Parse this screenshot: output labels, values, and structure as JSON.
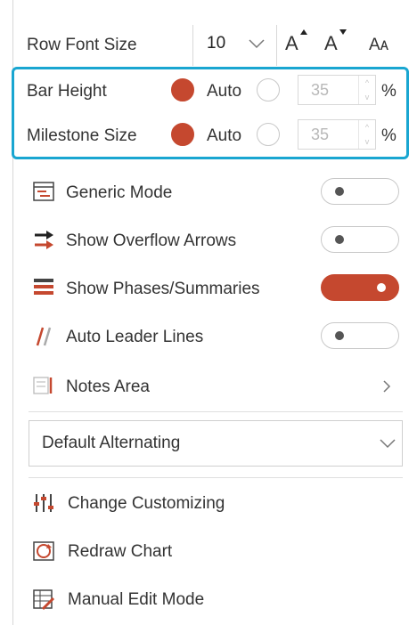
{
  "row_font": {
    "label": "Row Font Size",
    "value": "10",
    "grow_glyph": "A",
    "shrink_glyph": "A",
    "case_glyph": "Aᴀ"
  },
  "bar_height": {
    "label": "Bar Height",
    "auto_label": "Auto",
    "value": "35",
    "unit": "%",
    "auto_selected": true
  },
  "milestone_size": {
    "label": "Milestone Size",
    "auto_label": "Auto",
    "value": "35",
    "unit": "%",
    "auto_selected": true
  },
  "toggles": [
    {
      "label": "Generic Mode",
      "icon": "generic-mode-icon",
      "on": false
    },
    {
      "label": "Show Overflow Arrows",
      "icon": "overflow-arrows-icon",
      "on": false
    },
    {
      "label": "Show Phases/Summaries",
      "icon": "phases-summaries-icon",
      "on": true
    },
    {
      "label": "Auto Leader Lines",
      "icon": "leader-lines-icon",
      "on": false
    }
  ],
  "notes_area": {
    "label": "Notes Area",
    "icon": "notes-area-icon"
  },
  "dropdown": {
    "selected": "Default Alternating"
  },
  "actions": [
    {
      "label": "Change Customizing",
      "icon": "customizing-icon"
    },
    {
      "label": "Redraw Chart",
      "icon": "redraw-chart-icon"
    },
    {
      "label": "Manual Edit Mode",
      "icon": "manual-edit-icon"
    }
  ],
  "colors": {
    "accent": "#c5482f",
    "highlight": "#19a6d1"
  }
}
